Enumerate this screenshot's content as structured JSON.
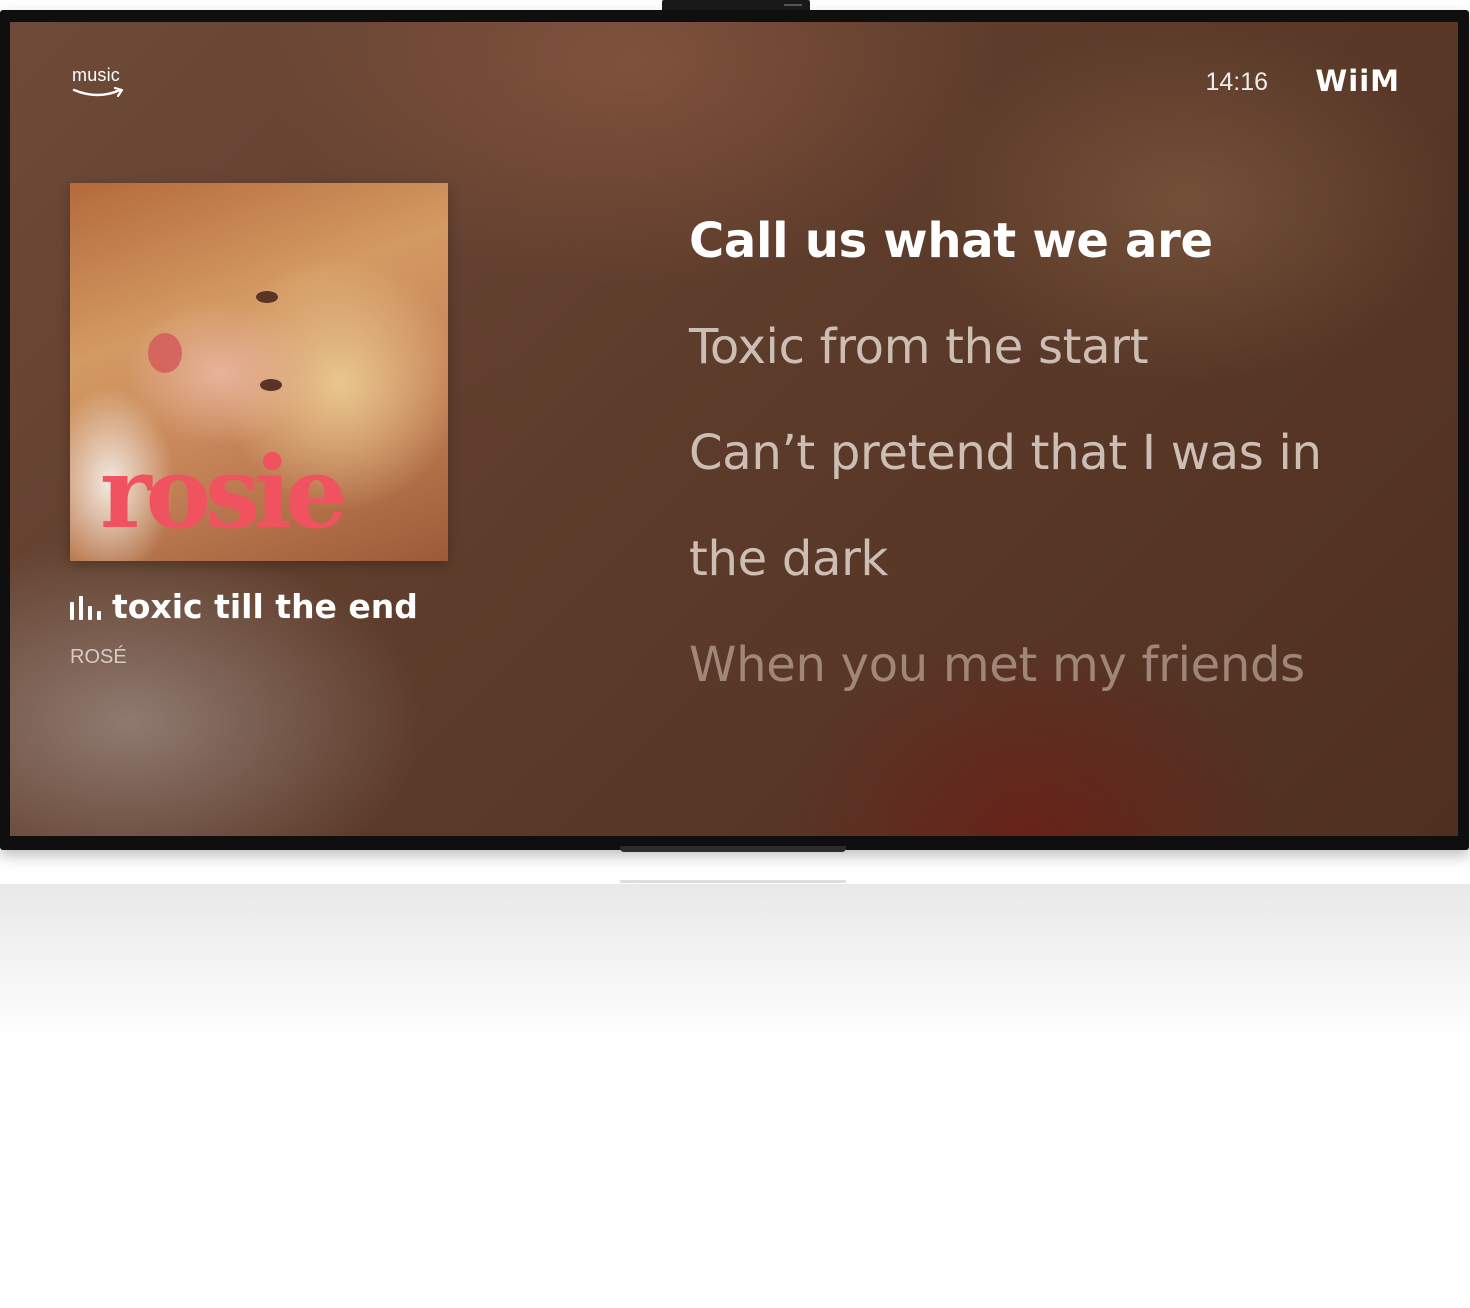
{
  "header": {
    "service_logo_text": "music",
    "clock": "14:16",
    "device_brand": "WiiM"
  },
  "album": {
    "art_title": "rosie",
    "title_color": "#f1525f"
  },
  "now_playing": {
    "track_title": "toxic till the end",
    "artist": "ROSÉ",
    "playing_icon": "equalizer-bars-icon"
  },
  "lyrics": {
    "current": "Call us what we are",
    "next": [
      "Toxic from the start",
      "Can’t pretend that I was in",
      "the dark"
    ],
    "later": "When you met my friends"
  },
  "colors": {
    "background": "#5e3c2b",
    "accent_text": "#ffffff",
    "dim_text": "#d9cdc5"
  }
}
